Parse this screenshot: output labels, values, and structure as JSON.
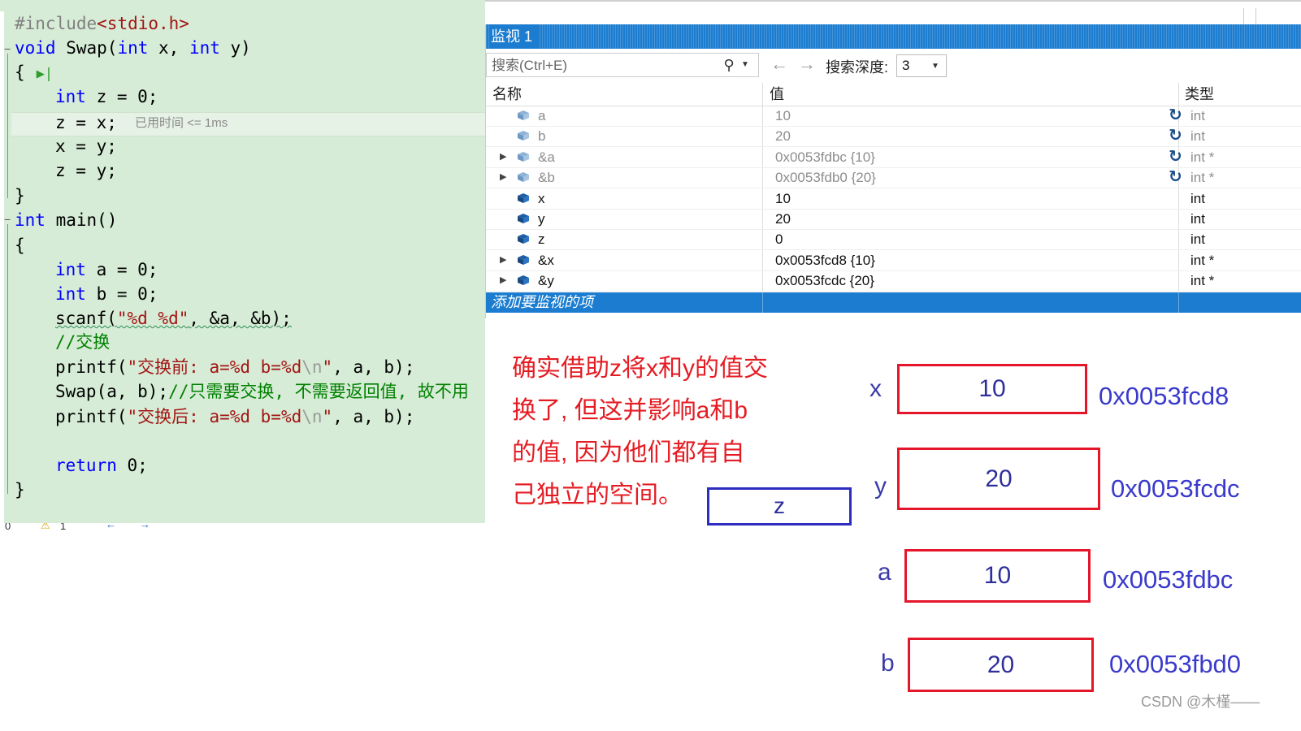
{
  "editor": {
    "lines": {
      "l1": {
        "pp": "#include",
        "inc": "<stdio.h>"
      },
      "l2": {
        "kw1": "void",
        "t1": " Swap(",
        "kw2": "int",
        "t2": " x, ",
        "kw3": "int",
        "t3": " y)"
      },
      "l3": {
        "t": "{"
      },
      "l4": {
        "kw": "int",
        "t": " z = 0;"
      },
      "l5": {
        "t": "z = x;"
      },
      "l6": {
        "t": "x = y;"
      },
      "l7": {
        "t": "z = y;"
      },
      "l8": {
        "t": "}"
      },
      "l9": {
        "kw": "int",
        "t": " main()"
      },
      "l10": {
        "t": "{"
      },
      "l11": {
        "kw": "int",
        "t": " a = 0;"
      },
      "l12": {
        "kw": "int",
        "t": " b = 0;"
      },
      "l13": {
        "t1": "scanf(",
        "str": "\"%d %d\"",
        "t2": ", &a, &b);"
      },
      "l14": {
        "cmt": "//交换"
      },
      "l15": {
        "t1": "printf(",
        "str1": "\"交换前: a=%d b=%d",
        "esc": "\\n",
        "str2": "\"",
        "t2": ", a, b);"
      },
      "l16": {
        "t": "Swap(a, b);",
        "cmt": "//只需要交换, 不需要返回值, 故不用"
      },
      "l17": {
        "t1": "printf(",
        "str1": "\"交换后: a=%d b=%d",
        "esc": "\\n",
        "str2": "\"",
        "t2": ", a, b);"
      },
      "l18": {
        "kw": "return",
        "t": " 0;"
      },
      "l19": {
        "t": "}"
      }
    },
    "elapsed_hint": "已用时间 <= 1ms",
    "status": {
      "col": "0",
      "warnings": "1"
    }
  },
  "watch": {
    "title": "监视 1",
    "search_placeholder": "搜索(Ctrl+E)",
    "depth_label": "搜索深度:",
    "depth_value": "3",
    "columns": {
      "name": "名称",
      "value": "值",
      "type": "类型"
    },
    "rows": [
      {
        "name": "a",
        "value": "10",
        "type": "int"
      },
      {
        "name": "b",
        "value": "20",
        "type": "int"
      },
      {
        "name": "&a",
        "value": "0x0053fdbc {10}",
        "type": "int *"
      },
      {
        "name": "&b",
        "value": "0x0053fdb0 {20}",
        "type": "int *"
      },
      {
        "name": "x",
        "value": "10",
        "type": "int"
      },
      {
        "name": "y",
        "value": "20",
        "type": "int"
      },
      {
        "name": "z",
        "value": "0",
        "type": "int"
      },
      {
        "name": "&x",
        "value": "0x0053fcd8 {10}",
        "type": "int *"
      },
      {
        "name": "&y",
        "value": "0x0053fcdc {20}",
        "type": "int *"
      }
    ],
    "add_item": "添加要监视的项"
  },
  "annotation": {
    "lines": [
      "确实借助z将x和y的值交",
      "换了, 但这并影响a和b",
      "的值, 因为他们都有自",
      "己独立的空间。"
    ],
    "z_label": "z",
    "memory": [
      {
        "label": "x",
        "value": "10",
        "address": "0x0053fcd8"
      },
      {
        "label": "y",
        "value": "20",
        "address": "0x0053fcdc"
      },
      {
        "label": "a",
        "value": "10",
        "address": "0x0053fdbc"
      },
      {
        "label": "b",
        "value": "20",
        "address": "0x0053fbd0"
      }
    ]
  },
  "watermark": "CSDN @木槿——",
  "colors": {
    "accent": "#1c7dd0",
    "annotation_red": "#e51c23",
    "annotation_blue": "#3a3aa8"
  }
}
